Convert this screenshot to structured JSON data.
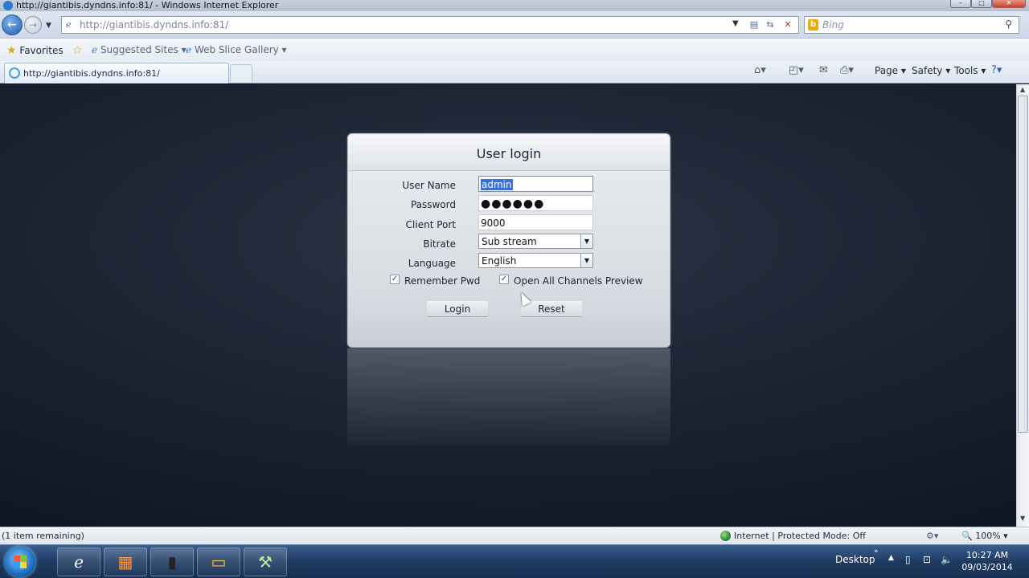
{
  "window": {
    "title": "http://giantibis.dyndns.info:81/ - Windows Internet Explorer"
  },
  "address_bar": {
    "url": "http://giantibis.dyndns.info:81/",
    "search_placeholder": "Bing"
  },
  "favorites_bar": {
    "favorites_label": "Favorites",
    "items": [
      "Suggested Sites",
      "Web Slice Gallery"
    ]
  },
  "tab": {
    "title": "http://giantibis.dyndns.info:81/"
  },
  "command_bar": {
    "page_label": "Page",
    "safety_label": "Safety",
    "tools_label": "Tools"
  },
  "login": {
    "title": "User login",
    "username_label": "User Name",
    "username_value": "admin",
    "password_label": "Password",
    "password_mask": "●●●●●●",
    "client_port_label": "Client Port",
    "client_port_value": "9000",
    "bitrate_label": "Bitrate",
    "bitrate_value": "Sub stream",
    "language_label": "Language",
    "language_value": "English",
    "remember_pwd_label": "Remember Pwd",
    "remember_pwd_checked": true,
    "open_channels_label": "Open All Channels Preview",
    "open_channels_checked": true,
    "login_button": "Login",
    "reset_button": "Reset"
  },
  "status_bar": {
    "left_text": "(1 item remaining)",
    "zone_text": "Internet | Protected Mode: Off",
    "zoom": "100%"
  },
  "taskbar": {
    "desktop_label": "Desktop",
    "time": "10:27 AM",
    "date": "09/03/2014"
  },
  "icons": {
    "back": "back-arrow-icon",
    "forward": "forward-arrow-icon",
    "refresh": "refresh-icon",
    "stop": "stop-icon",
    "search": "search-icon",
    "home": "home-icon",
    "feeds": "rss-icon",
    "mail": "mail-icon",
    "print": "print-icon",
    "help": "help-icon"
  },
  "colors": {
    "selection": "#3b6fd8",
    "panel_background": "#e5e8ec",
    "page_background": "#1d2434",
    "taskbar": "#1f3a61"
  }
}
